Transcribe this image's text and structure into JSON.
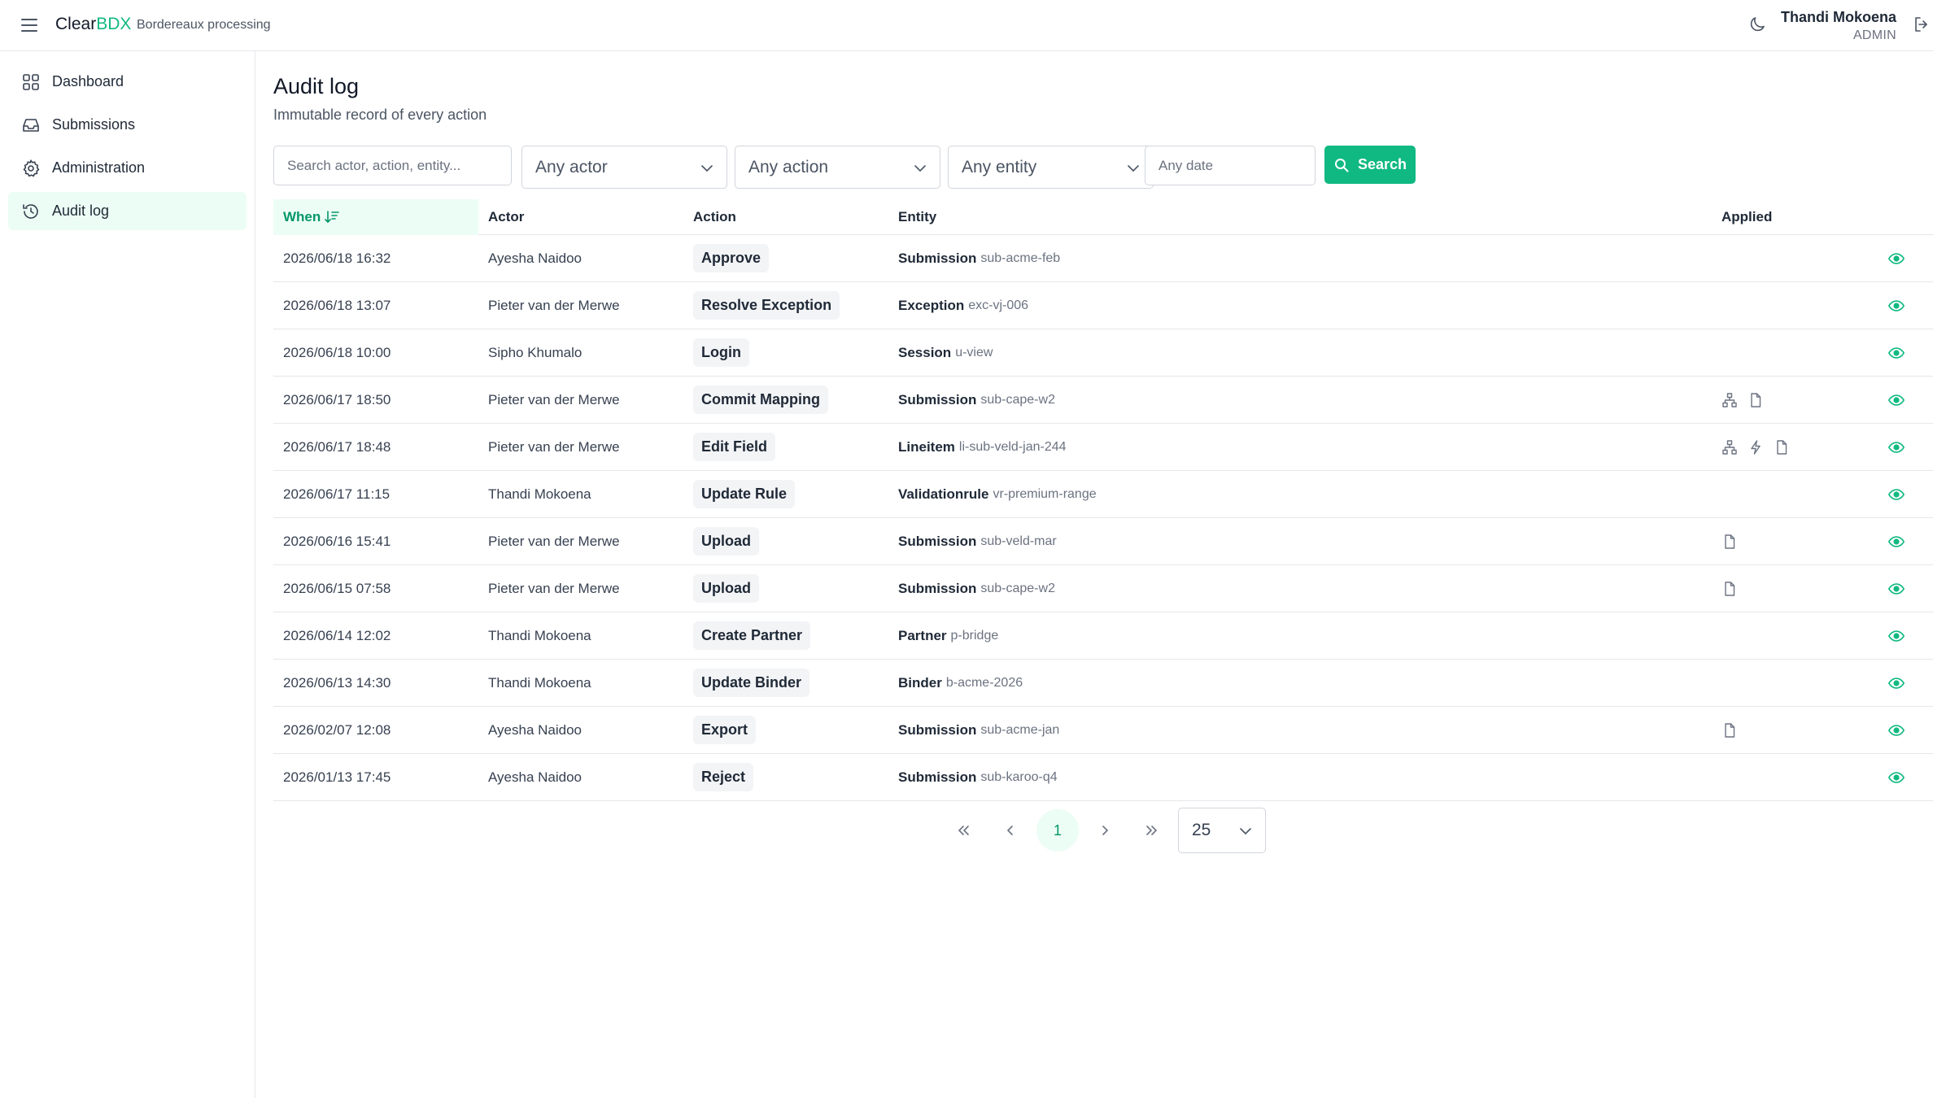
{
  "app": {
    "brand_part1": "Clear",
    "brand_part2": "BDX",
    "tagline": "Bordereaux processing",
    "accent_color": "#10b981"
  },
  "user": {
    "name": "Thandi Mokoena",
    "role": "ADMIN"
  },
  "sidebar": {
    "items": [
      {
        "label": "Dashboard",
        "icon": "grid-icon",
        "active": false
      },
      {
        "label": "Submissions",
        "icon": "inbox-icon",
        "active": false
      },
      {
        "label": "Administration",
        "icon": "gear-icon",
        "active": false
      },
      {
        "label": "Audit log",
        "icon": "history-icon",
        "active": true
      }
    ]
  },
  "page": {
    "title": "Audit log",
    "subtitle": "Immutable record of every action"
  },
  "filters": {
    "search_placeholder": "Search actor, action, entity...",
    "actor_value": "Any actor",
    "action_value": "Any action",
    "entity_value": "Any entity",
    "date_placeholder": "Any date",
    "search_button": "Search"
  },
  "table": {
    "headers": {
      "when": "When",
      "actor": "Actor",
      "action": "Action",
      "entity": "Entity",
      "applied": "Applied"
    },
    "rows": [
      {
        "when": "2026/06/18 16:32",
        "actor": "Ayesha Naidoo",
        "action": "Approve",
        "entity_type": "Submission",
        "entity_id": "sub-acme-feb",
        "applied": []
      },
      {
        "when": "2026/06/18 13:07",
        "actor": "Pieter van der Merwe",
        "action": "Resolve Exception",
        "entity_type": "Exception",
        "entity_id": "exc-vj-006",
        "applied": []
      },
      {
        "when": "2026/06/18 10:00",
        "actor": "Sipho Khumalo",
        "action": "Login",
        "entity_type": "Session",
        "entity_id": "u-view",
        "applied": []
      },
      {
        "when": "2026/06/17 18:50",
        "actor": "Pieter van der Merwe",
        "action": "Commit Mapping",
        "entity_type": "Submission",
        "entity_id": "sub-cape-w2",
        "applied": [
          "hierarchy-icon",
          "file-icon"
        ]
      },
      {
        "when": "2026/06/17 18:48",
        "actor": "Pieter van der Merwe",
        "action": "Edit Field",
        "entity_type": "Lineitem",
        "entity_id": "li-sub-veld-jan-244",
        "applied": [
          "hierarchy-icon",
          "bolt-icon",
          "file-icon"
        ]
      },
      {
        "when": "2026/06/17 11:15",
        "actor": "Thandi Mokoena",
        "action": "Update Rule",
        "entity_type": "Validationrule",
        "entity_id": "vr-premium-range",
        "applied": []
      },
      {
        "when": "2026/06/16 15:41",
        "actor": "Pieter van der Merwe",
        "action": "Upload",
        "entity_type": "Submission",
        "entity_id": "sub-veld-mar",
        "applied": [
          "file-icon"
        ]
      },
      {
        "when": "2026/06/15 07:58",
        "actor": "Pieter van der Merwe",
        "action": "Upload",
        "entity_type": "Submission",
        "entity_id": "sub-cape-w2",
        "applied": [
          "file-icon"
        ]
      },
      {
        "when": "2026/06/14 12:02",
        "actor": "Thandi Mokoena",
        "action": "Create Partner",
        "entity_type": "Partner",
        "entity_id": "p-bridge",
        "applied": []
      },
      {
        "when": "2026/06/13 14:30",
        "actor": "Thandi Mokoena",
        "action": "Update Binder",
        "entity_type": "Binder",
        "entity_id": "b-acme-2026",
        "applied": []
      },
      {
        "when": "2026/02/07 12:08",
        "actor": "Ayesha Naidoo",
        "action": "Export",
        "entity_type": "Submission",
        "entity_id": "sub-acme-jan",
        "applied": [
          "file-icon"
        ]
      },
      {
        "when": "2026/01/13 17:45",
        "actor": "Ayesha Naidoo",
        "action": "Reject",
        "entity_type": "Submission",
        "entity_id": "sub-karoo-q4",
        "applied": []
      }
    ]
  },
  "pagination": {
    "current_page": "1",
    "page_size": "25"
  }
}
